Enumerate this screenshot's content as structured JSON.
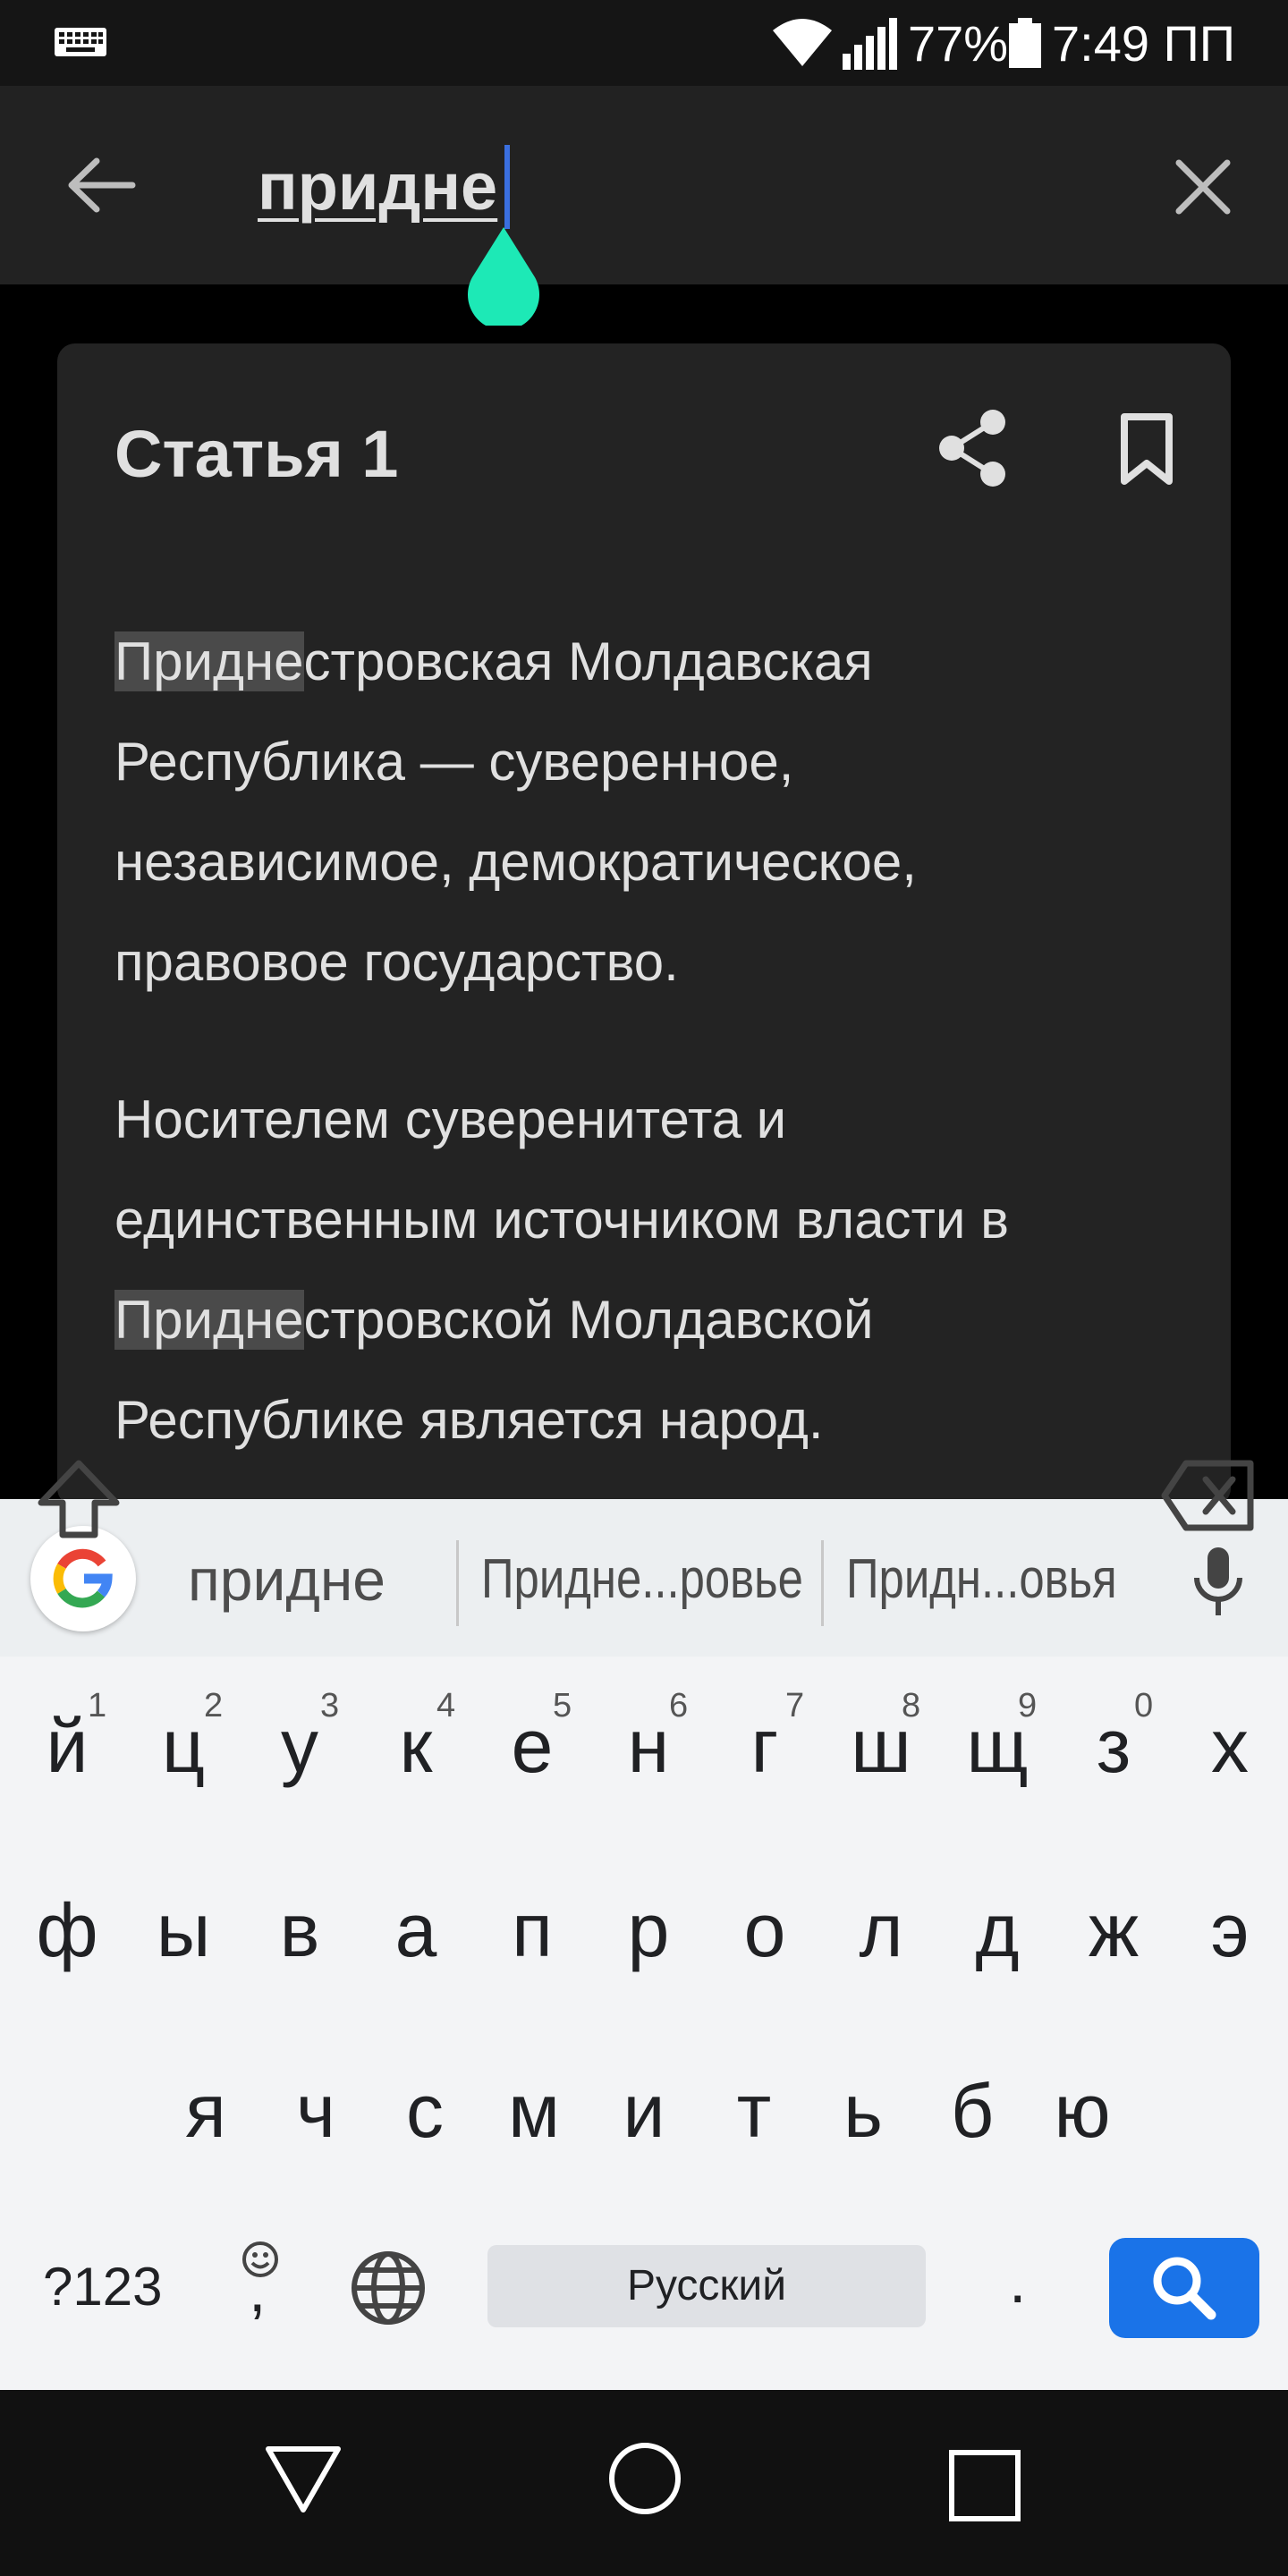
{
  "status_bar": {
    "battery": "77%",
    "time": "7:49 ПП"
  },
  "search": {
    "query": "придне"
  },
  "article": {
    "title": "Статья 1",
    "paragraphs": [
      {
        "highlight": "Придне",
        "lines": [
          "стровская Молдавская",
          "Республика — суверенное,",
          "независимое, демократическое,",
          "правовое государство."
        ]
      },
      {
        "line1": "Носителем суверенитета и",
        "line2": "единственным источником власти в",
        "highlight": "Придне",
        "line3_rest": "стровской Молдавской",
        "line4": "Республике является народ."
      }
    ]
  },
  "keyboard": {
    "suggestions": [
      "придне",
      "Придне...ровье",
      "Придн...овья"
    ],
    "row1": [
      {
        "key": "й",
        "hint": "1"
      },
      {
        "key": "ц",
        "hint": "2"
      },
      {
        "key": "у",
        "hint": "3"
      },
      {
        "key": "к",
        "hint": "4"
      },
      {
        "key": "е",
        "hint": "5"
      },
      {
        "key": "н",
        "hint": "6"
      },
      {
        "key": "г",
        "hint": "7"
      },
      {
        "key": "ш",
        "hint": "8"
      },
      {
        "key": "щ",
        "hint": "9"
      },
      {
        "key": "з",
        "hint": "0"
      },
      {
        "key": "х",
        "hint": ""
      }
    ],
    "row2": [
      "ф",
      "ы",
      "в",
      "а",
      "п",
      "р",
      "о",
      "л",
      "д",
      "ж",
      "э"
    ],
    "row3": [
      "я",
      "ч",
      "с",
      "м",
      "и",
      "т",
      "ь",
      "б",
      "ю"
    ],
    "num_key": "?123",
    "emoji_comma": ",",
    "space": "Русский",
    "period": "."
  }
}
